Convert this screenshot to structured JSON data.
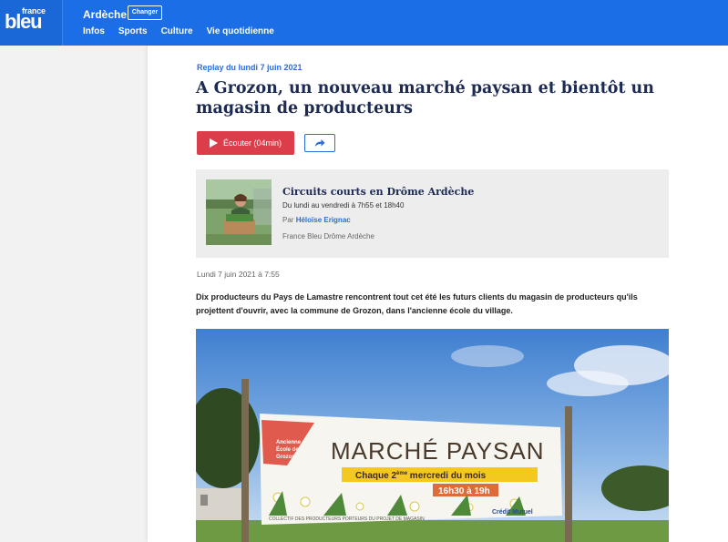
{
  "header": {
    "logo_top": "france",
    "logo_main": "bleu",
    "region": "Ardèche",
    "change_label": "Changer",
    "nav": [
      "Infos",
      "Sports",
      "Culture",
      "Vie quotidienne"
    ]
  },
  "article": {
    "replay_label": "Replay du lundi 7 juin 2021",
    "title": "A Grozon, un nouveau marché paysan et bientôt un magasin de producteurs",
    "listen_label": "Écouter (04min)",
    "emission": {
      "title": "Circuits courts en Drôme Ardèche",
      "schedule": "Du lundi au vendredi à 7h55 et 18h40",
      "author_prefix": "Par",
      "author": "Héloïse Erignac",
      "station": "France Bleu Drôme Ardèche"
    },
    "date": "Lundi 7 juin 2021 à 7:55",
    "lead": "Dix producteurs du Pays de Lamastre rencontrent tout cet été les futurs clients du magasin de producteurs qu'ils projettent d'ouvrir, avec la commune de Grozon, dans l'ancienne école du village.",
    "banner": {
      "arrow_line1": "Ancienne",
      "arrow_line2": "École de",
      "arrow_line3": "Grozon",
      "main": "MARCHÉ PAYSAN",
      "sub_pre": "Chaque 2",
      "sub_sup": "ème",
      "sub_post": " mercredi du mois",
      "hours": "16h30 à 19h",
      "footer_left": "COLLECTIF DES PRODUCTEURS PORTEURS DU PROJET DE MAGASIN",
      "footer_right": "Crédit Mutuel"
    }
  },
  "colors": {
    "brand_blue": "#1c6ee6",
    "listen_red": "#dc3d4a",
    "title_navy": "#1d2a52",
    "link_blue": "#2c6dd6"
  }
}
